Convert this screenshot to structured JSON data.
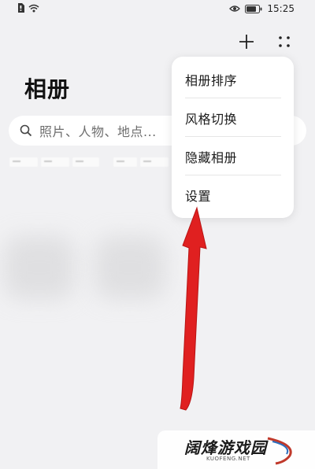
{
  "status_bar": {
    "time": "15:25",
    "icons": [
      "sim-icon",
      "wifi-icon",
      "eye-icon",
      "battery-icon"
    ]
  },
  "toolbar": {
    "add_icon": "plus-icon",
    "more_icon": "more-dots-icon"
  },
  "page": {
    "title": "相册"
  },
  "search": {
    "placeholder": "照片、人物、地点..."
  },
  "menu": {
    "items": [
      {
        "label": "相册排序"
      },
      {
        "label": "风格切换"
      },
      {
        "label": "隐藏相册"
      },
      {
        "label": "设置"
      }
    ]
  },
  "annotation": {
    "color": "#e02020",
    "points_to": "设置"
  },
  "watermark": {
    "title": "阔烽游戏园",
    "url": "KUOFENG.NET"
  }
}
